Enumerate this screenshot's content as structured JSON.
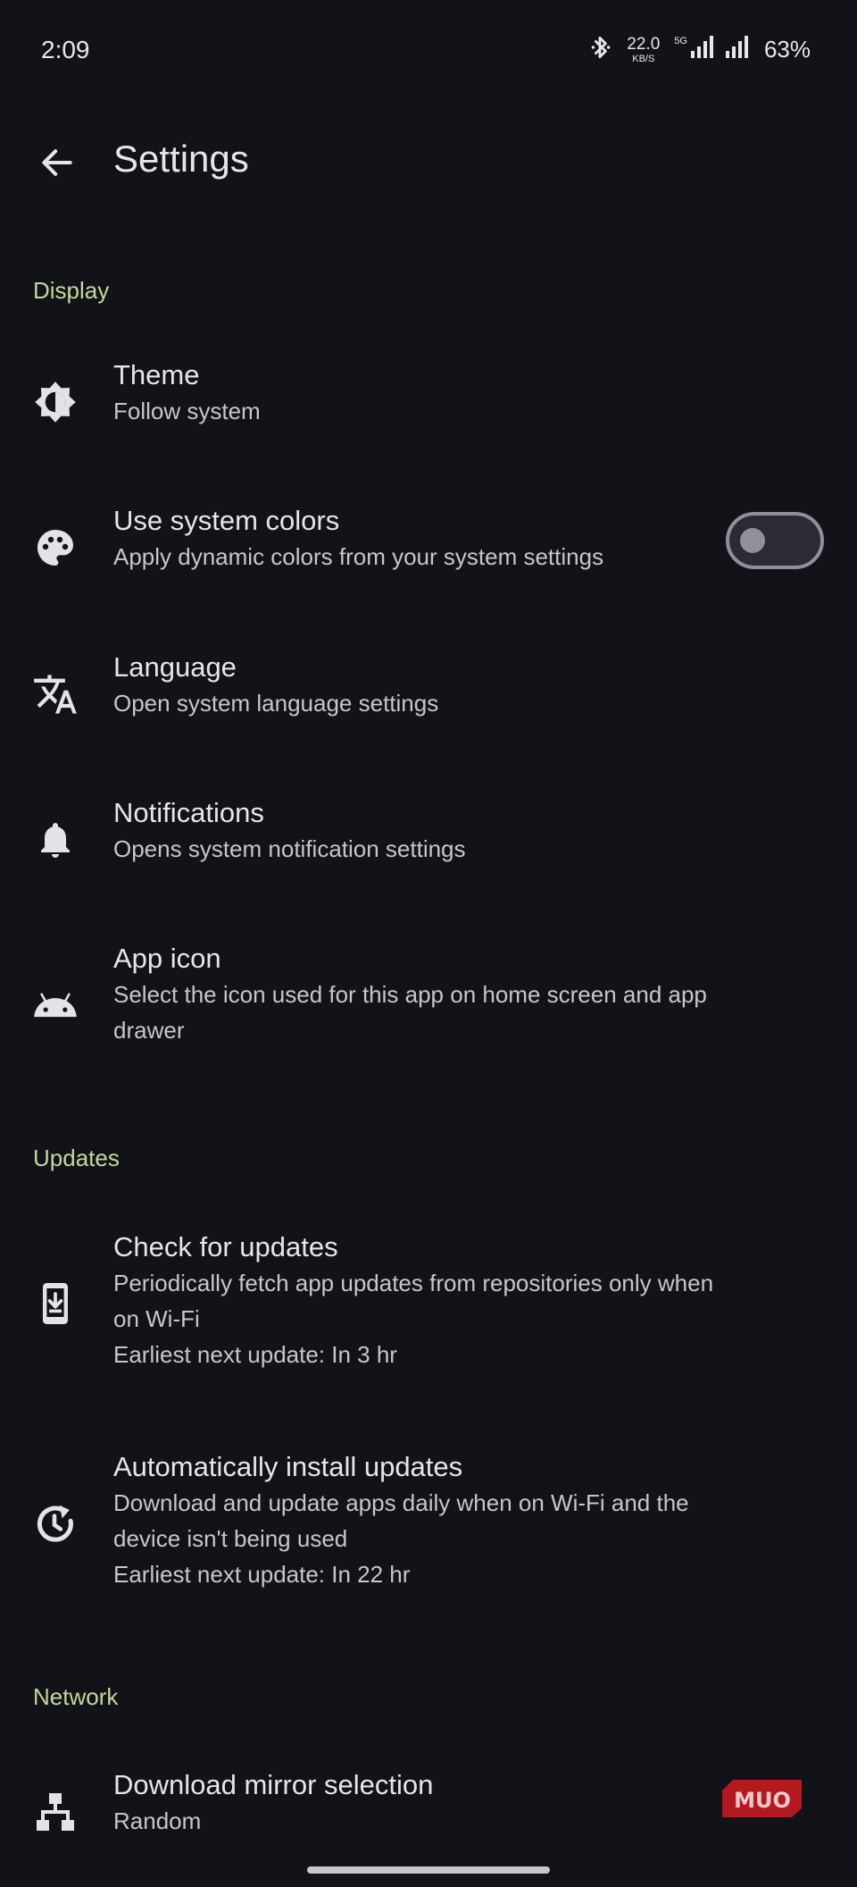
{
  "status_bar": {
    "time": "2:09",
    "net_speed": "22.0",
    "net_speed_unit": "KB/S",
    "network_type": "5G",
    "battery": "63%"
  },
  "header": {
    "title": "Settings"
  },
  "sections": [
    {
      "header": "Display",
      "items": [
        {
          "title": "Theme",
          "subtitle": "Follow system",
          "icon": "theme-icon"
        },
        {
          "title": "Use system colors",
          "subtitle": "Apply dynamic colors from your system settings",
          "icon": "palette-icon",
          "toggle": false
        },
        {
          "title": "Language",
          "subtitle": "Open system language settings",
          "icon": "translate-icon"
        },
        {
          "title": "Notifications",
          "subtitle": "Opens system notification settings",
          "icon": "bell-icon"
        },
        {
          "title": "App icon",
          "subtitle": "Select the icon used for this app on home screen and app",
          "subtitle2": "drawer",
          "icon": "android-icon"
        }
      ]
    },
    {
      "header": "Updates",
      "items": [
        {
          "title": "Check for updates",
          "subtitle": "Periodically fetch app updates from repositories only when",
          "subtitle2": "on Wi-Fi",
          "subtitle3": "Earliest next update: In 3 hr",
          "icon": "system-update-icon"
        },
        {
          "title": "Automatically install updates",
          "subtitle": "Download and update apps daily when on Wi-Fi and the",
          "subtitle2": "device isn't being used",
          "subtitle3": "Earliest next update: In 22 hr",
          "icon": "update-clock-icon"
        }
      ]
    },
    {
      "header": "Network",
      "items": [
        {
          "title": "Download mirror selection",
          "subtitle": "Random",
          "icon": "lan-icon"
        }
      ]
    }
  ],
  "watermark": "MUO",
  "colors": {
    "background": "#121318",
    "section_header": "#c3d89a",
    "watermark": "#b3191f"
  }
}
